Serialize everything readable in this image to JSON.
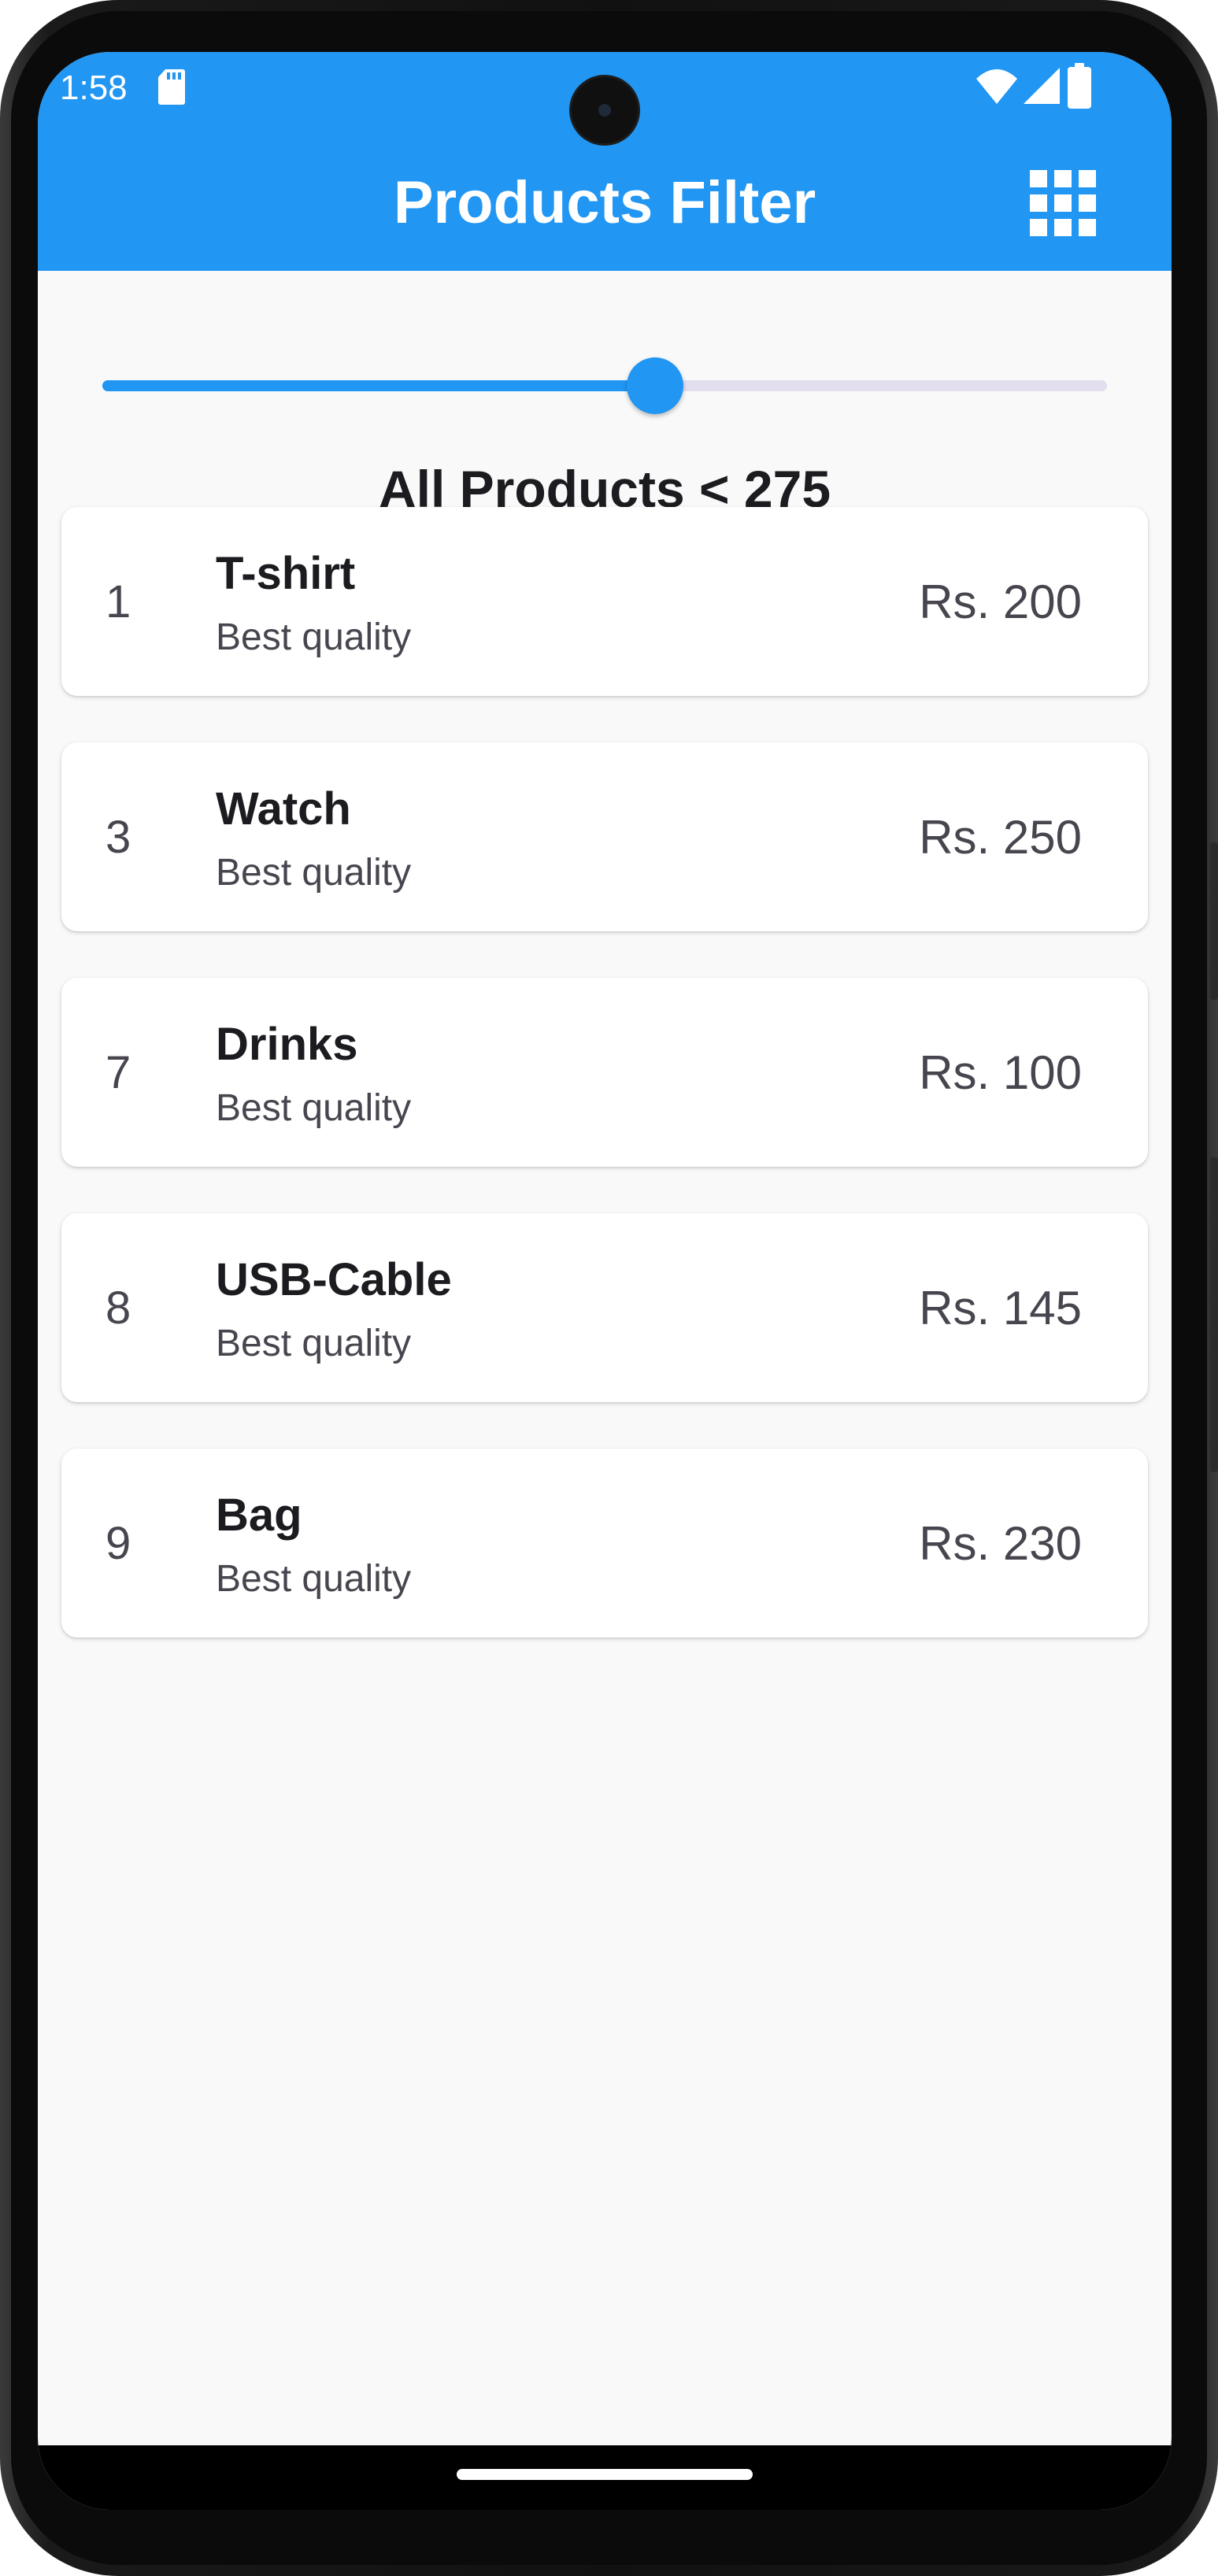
{
  "status_bar": {
    "time": "1:58"
  },
  "app_bar": {
    "title": "Products Filter",
    "action_icon": "grid-view-icon",
    "color": "#2196f3"
  },
  "slider": {
    "value": 275,
    "fraction": 0.55,
    "active_color": "#2196f3"
  },
  "filter_label": "All Products < 275",
  "products": [
    {
      "id": "1",
      "name": "T-shirt",
      "subtitle": "Best quality",
      "price": "Rs. 200"
    },
    {
      "id": "3",
      "name": "Watch",
      "subtitle": "Best quality",
      "price": "Rs. 250"
    },
    {
      "id": "7",
      "name": "Drinks",
      "subtitle": "Best quality",
      "price": "Rs. 100"
    },
    {
      "id": "8",
      "name": "USB-Cable",
      "subtitle": "Best quality",
      "price": "Rs. 145"
    },
    {
      "id": "9",
      "name": "Bag",
      "subtitle": "Best quality",
      "price": "Rs. 230"
    }
  ]
}
